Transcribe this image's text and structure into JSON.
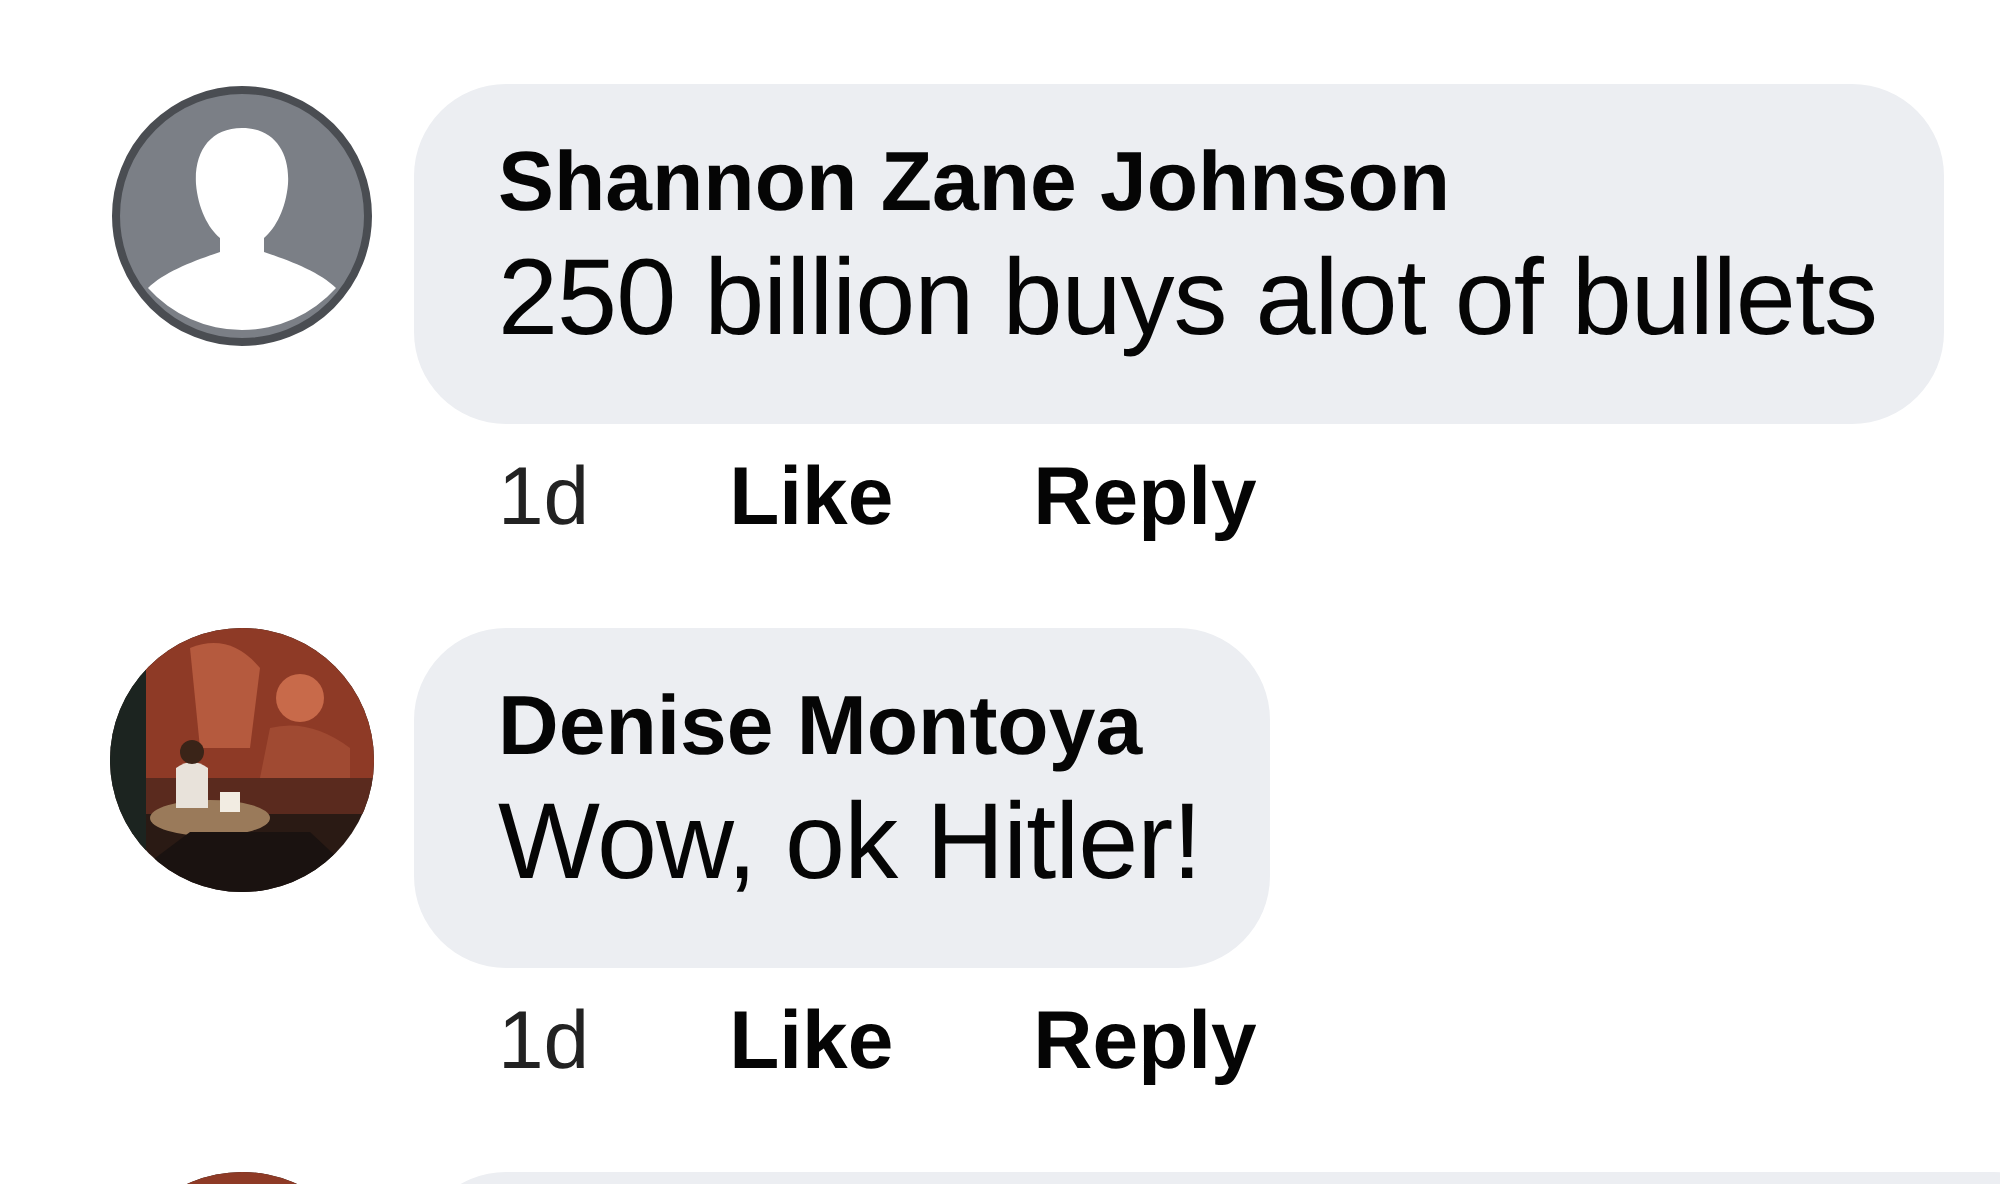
{
  "comments": [
    {
      "avatar": {
        "kind": "default"
      },
      "author": "Shannon Zane Johnson",
      "text": "250 billion buys alot of bullets",
      "time": "1d",
      "like": "Like",
      "reply": "Reply"
    },
    {
      "avatar": {
        "kind": "picture"
      },
      "author": "Denise Montoya",
      "text": "Wow, ok Hitler!",
      "time": "1d",
      "like": "Like",
      "reply": "Reply"
    },
    {
      "avatar": {
        "kind": "picture"
      }
    }
  ]
}
